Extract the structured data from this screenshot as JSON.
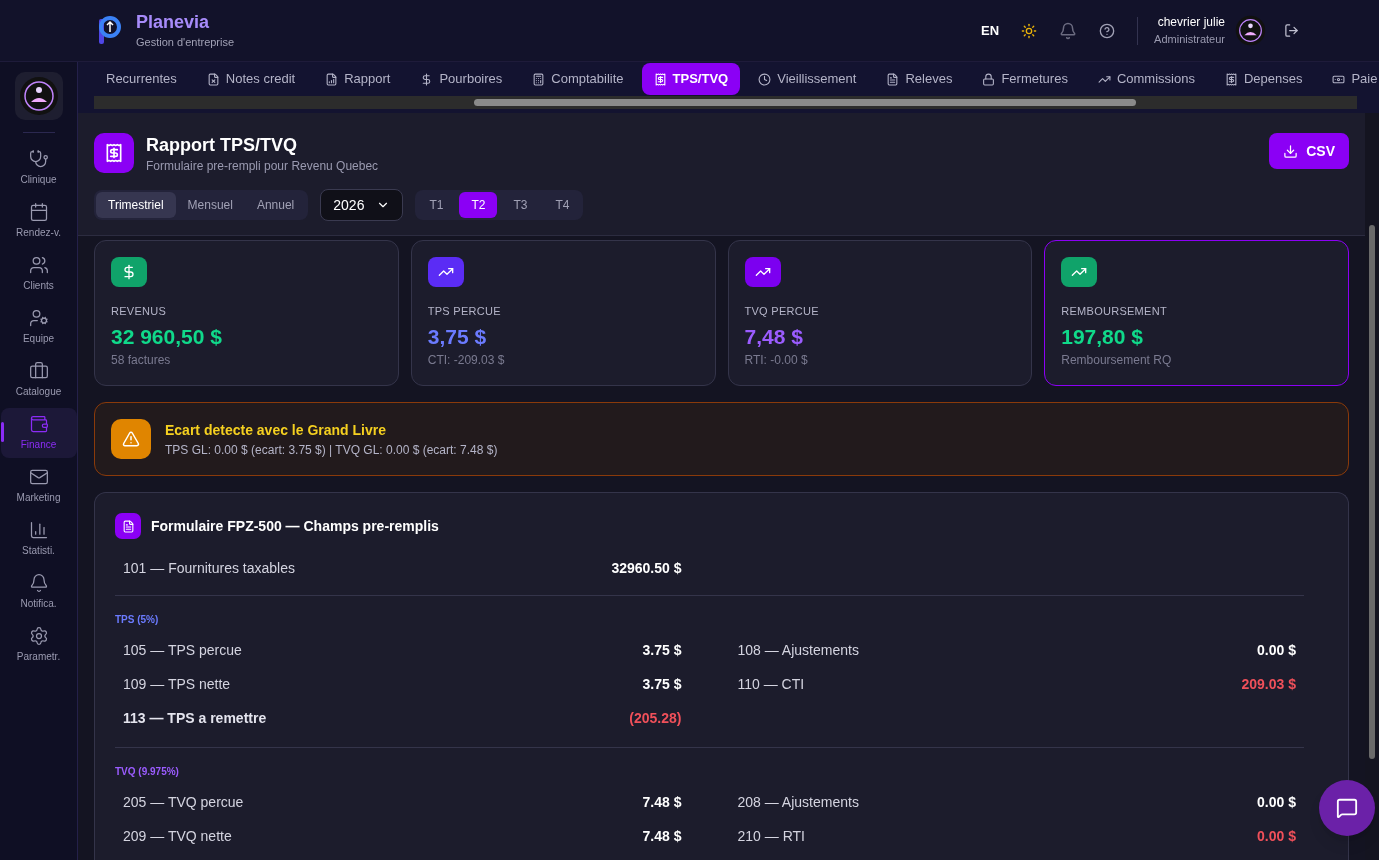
{
  "header": {
    "brand": "Planevia",
    "subtitle": "Gestion d'entreprise",
    "language": "EN",
    "user": {
      "name": "chevrier julie",
      "role": "Administrateur"
    }
  },
  "sidebar": {
    "items": [
      {
        "label": "Clinique",
        "selected": false
      },
      {
        "label": "Rendez-v.",
        "selected": false
      },
      {
        "label": "Clients",
        "selected": false
      },
      {
        "label": "Equipe",
        "selected": false
      },
      {
        "label": "Catalogue",
        "selected": false
      },
      {
        "label": "Finance",
        "selected": true
      },
      {
        "label": "Marketing",
        "selected": false
      },
      {
        "label": "Statisti.",
        "selected": false
      },
      {
        "label": "Notifica.",
        "selected": false
      },
      {
        "label": "Parametr.",
        "selected": false
      }
    ]
  },
  "tabs": [
    {
      "label": "Recurrentes",
      "selected": false
    },
    {
      "label": "Notes credit",
      "selected": false
    },
    {
      "label": "Rapport",
      "selected": false
    },
    {
      "label": "Pourboires",
      "selected": false
    },
    {
      "label": "Comptabilite",
      "selected": false
    },
    {
      "label": "TPS/TVQ",
      "selected": true
    },
    {
      "label": "Vieillissement",
      "selected": false
    },
    {
      "label": "Releves",
      "selected": false
    },
    {
      "label": "Fermetures",
      "selected": false
    },
    {
      "label": "Commissions",
      "selected": false
    },
    {
      "label": "Depenses",
      "selected": false
    },
    {
      "label": "Paie",
      "selected": false
    }
  ],
  "page": {
    "title": "Rapport TPS/TVQ",
    "subtitle": "Formulaire pre-rempli pour Revenu Quebec",
    "export_button": "CSV"
  },
  "periods": [
    {
      "label": "Trimestriel",
      "selected": true
    },
    {
      "label": "Mensuel",
      "selected": false
    },
    {
      "label": "Annuel",
      "selected": false
    }
  ],
  "year": {
    "value": "2026"
  },
  "quarters": [
    {
      "label": "T1",
      "selected": false
    },
    {
      "label": "T2",
      "selected": true
    },
    {
      "label": "T3",
      "selected": false
    },
    {
      "label": "T4",
      "selected": false
    }
  ],
  "cards": [
    {
      "label": "REVENUS",
      "value": "32 960,50 $",
      "note": "58 factures",
      "kind": "dollar",
      "color": "#10d98a",
      "selected": false
    },
    {
      "label": "TPS PERCUE",
      "value": "3,75 $",
      "note": "CTI: -209.03 $",
      "kind": "trend",
      "color": "#6b7bff",
      "selected": false
    },
    {
      "label": "TVQ PERCUE",
      "value": "7,48 $",
      "note": "RTI: -0.00 $",
      "kind": "trend",
      "color": "#9b5cff",
      "selected": false
    },
    {
      "label": "REMBOURSEMENT",
      "value": "197,80 $",
      "note": "Remboursement RQ",
      "kind": "trend",
      "color": "#10d98a",
      "selected": true
    }
  ],
  "alert": {
    "title": "Ecart detecte avec le Grand Livre",
    "text": "TPS GL: 0.00 $ (ecart: 3.75 $) | TVQ GL: 0.00 $ (ecart: 7.48 $)"
  },
  "form": {
    "title": "Formulaire FPZ-500 — Champs pre-remplis",
    "first_line": {
      "label": "101 — Fournitures taxables",
      "value": "32960.50 $"
    },
    "sections": [
      {
        "heading": "TPS (5%)",
        "color": "#6b7bff",
        "lines": [
          {
            "label": "105 — TPS percue",
            "value": "3.75 $",
            "bold": false,
            "negative": false
          },
          {
            "label": "108 — Ajustements",
            "value": "0.00 $",
            "bold": false,
            "negative": false
          },
          {
            "label": "109 — TPS nette",
            "value": "3.75 $",
            "bold": false,
            "negative": false
          },
          {
            "label": "110 — CTI",
            "value": "209.03 $",
            "bold": false,
            "negative": true
          },
          {
            "label": "113 — TPS a remettre",
            "value": "(205.28)",
            "bold": true,
            "negative": true
          }
        ]
      },
      {
        "heading": "TVQ (9.975%)",
        "color": "#9b5cff",
        "lines": [
          {
            "label": "205 — TVQ percue",
            "value": "7.48 $",
            "bold": false,
            "negative": false
          },
          {
            "label": "208 — Ajustements",
            "value": "0.00 $",
            "bold": false,
            "negative": false
          },
          {
            "label": "209 — TVQ nette",
            "value": "7.48 $",
            "bold": false,
            "negative": false
          },
          {
            "label": "210 — RTI",
            "value": "0.00 $",
            "bold": false,
            "negative": true
          }
        ]
      }
    ]
  }
}
